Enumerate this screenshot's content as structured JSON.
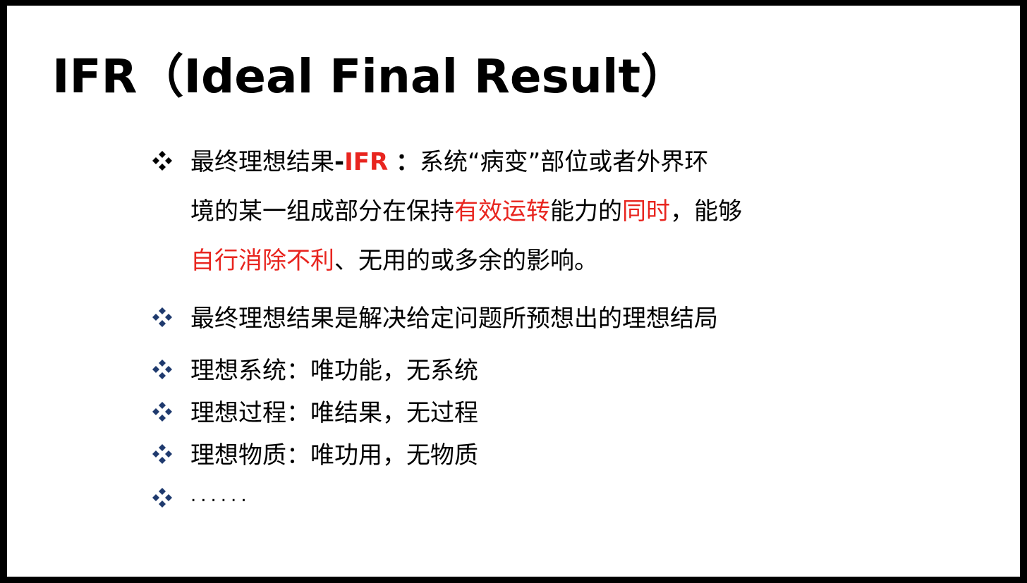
{
  "title": "IFR（Ideal Final Result）",
  "colors": {
    "accent": "#e8251f",
    "bullet_first": "#000000",
    "bullet_navy": "#1f3a6e"
  },
  "bullets": [
    {
      "icon": "diamond-bullet-icon",
      "lines": [
        [
          "最终理想结果",
          "-",
          "IFR",
          " ",
          "：",
          "系统“病变”部位或者外界环"
        ],
        [
          "境的某一组成部分在保持",
          "有效运转",
          "能力的",
          "同时",
          "，能够"
        ],
        [
          "自行消除不利",
          "、无用的或多余的影响。"
        ]
      ]
    },
    {
      "icon": "diamond-bullet-icon",
      "text": "最终理想结果是解决给定问题所预想出的理想结局"
    },
    {
      "icon": "diamond-bullet-icon",
      "text": "理想系统：唯功能，无系统"
    },
    {
      "icon": "diamond-bullet-icon",
      "text": "理想过程：唯结果，无过程"
    },
    {
      "icon": "diamond-bullet-icon",
      "text": "理想物质：唯功用，无物质"
    },
    {
      "icon": "diamond-bullet-icon",
      "text": "......"
    }
  ]
}
